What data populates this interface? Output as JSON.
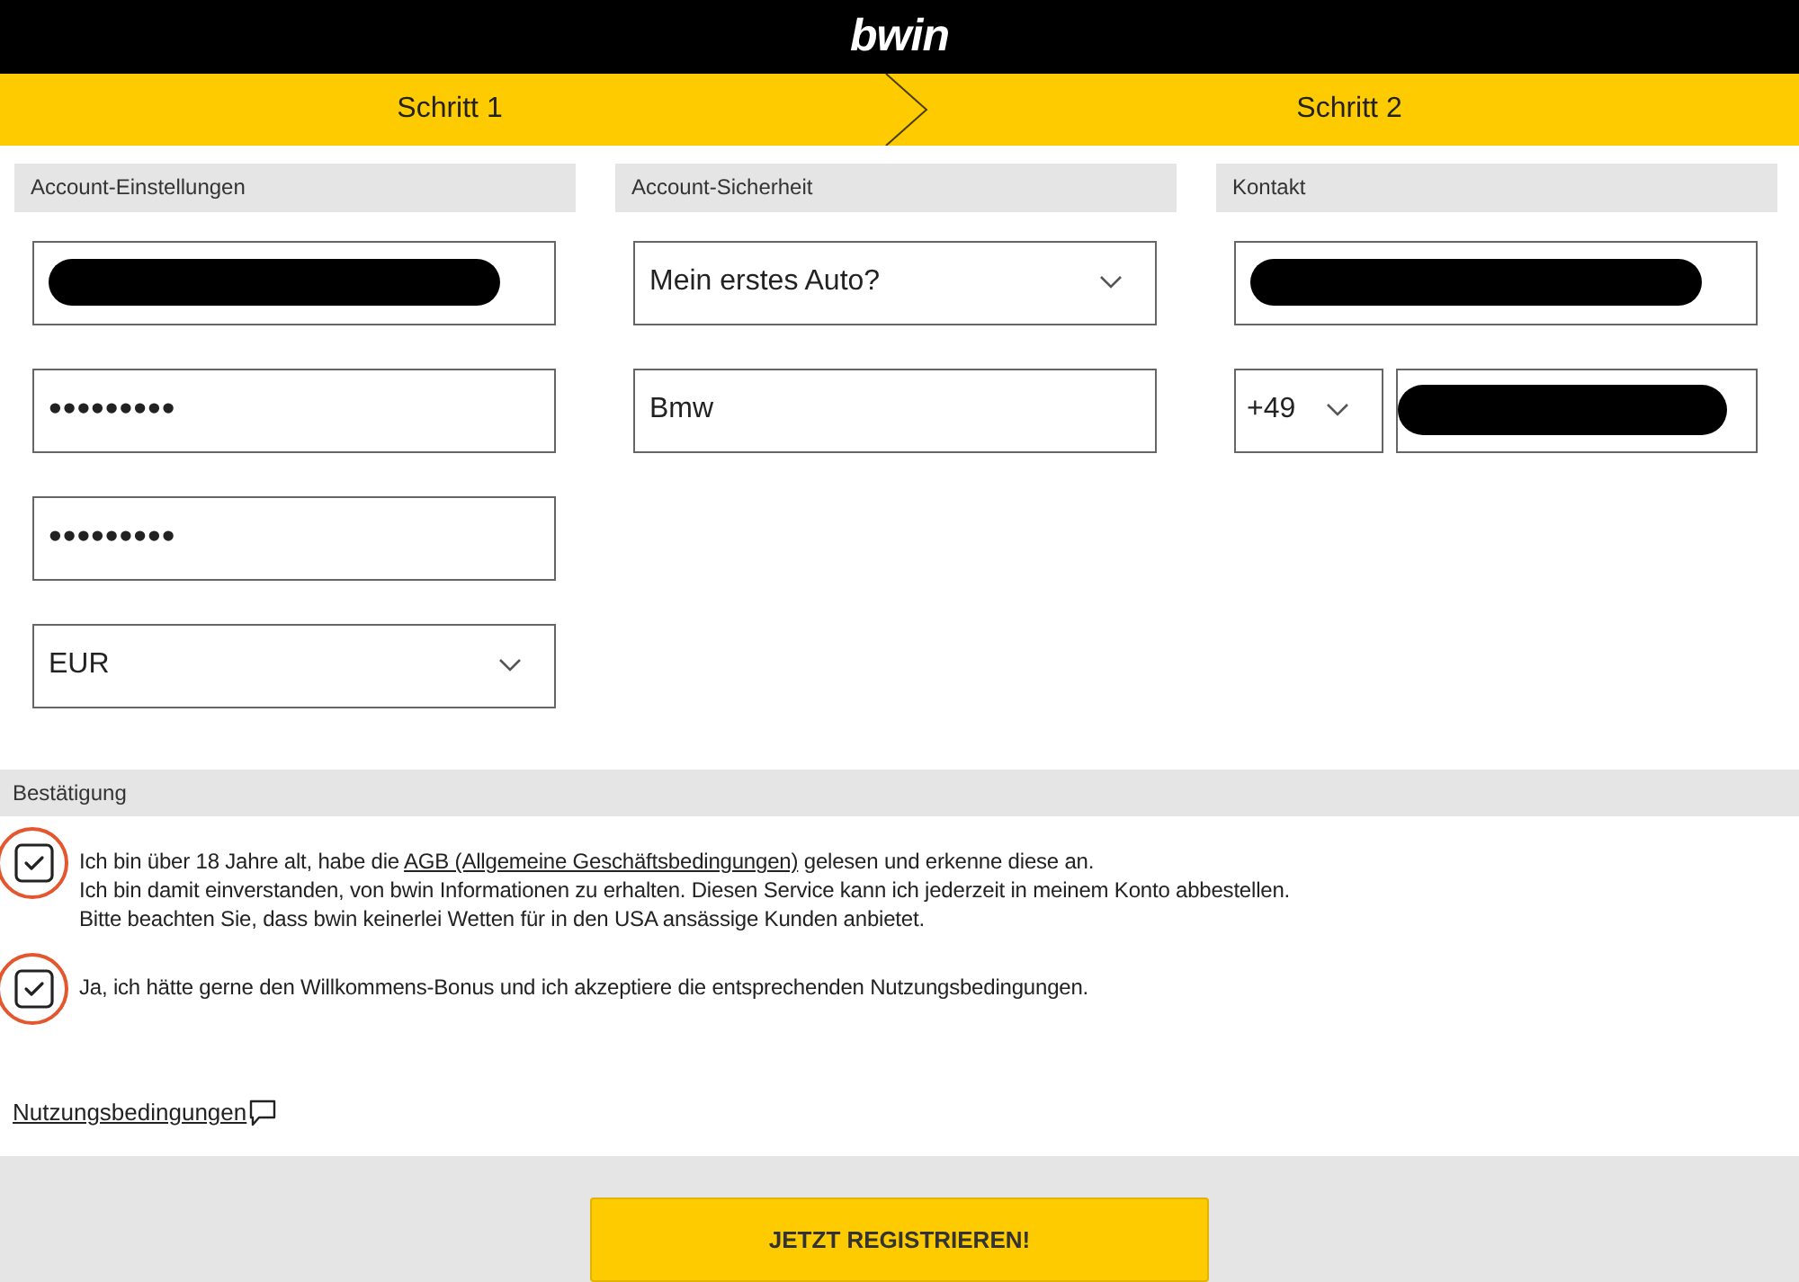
{
  "header": {
    "logo": "bwin"
  },
  "steps": [
    {
      "label": "Schritt 1"
    },
    {
      "label": "Schritt 2"
    }
  ],
  "sections": [
    {
      "title": "Account-Einstellungen",
      "fields": [
        {
          "kind": "text",
          "redacted": true
        },
        {
          "kind": "password",
          "value": "•••••••••"
        },
        {
          "kind": "password",
          "value": "•••••••••"
        },
        {
          "kind": "select",
          "value": "EUR"
        }
      ]
    },
    {
      "title": "Account-Sicherheit",
      "fields": [
        {
          "kind": "select",
          "value": "Mein erstes Auto?"
        },
        {
          "kind": "text",
          "value": "Bmw"
        }
      ]
    },
    {
      "title": "Kontakt",
      "fields": [
        {
          "kind": "text",
          "redacted": true
        },
        {
          "kind": "phone",
          "prefix": "+49",
          "redacted": true
        }
      ]
    }
  ],
  "confirmation": {
    "title": "Bestätigung",
    "consents": [
      {
        "checked": true,
        "highlighted": true,
        "lines": [
          [
            {
              "kind": "text",
              "text": "Ich bin über 18 Jahre alt, habe die "
            },
            {
              "kind": "link",
              "text": "AGB (Allgemeine Geschäftsbedingungen)"
            },
            {
              "kind": "text",
              "text": " gelesen und erkenne diese an."
            }
          ],
          [
            {
              "kind": "text",
              "text": "Ich bin damit einverstanden, von bwin Informationen zu erhalten. Diesen Service kann ich jederzeit in meinem Konto abbestellen."
            }
          ],
          [
            {
              "kind": "text",
              "text": "Bitte beachten Sie, dass bwin keinerlei Wetten für in den USA ansässige Kunden anbietet."
            }
          ]
        ]
      },
      {
        "checked": true,
        "highlighted": true,
        "lines": [
          [
            {
              "kind": "text",
              "text": "Ja, ich hätte gerne den Willkommens-Bonus und ich akzeptiere die entsprechenden Nutzungsbedingungen."
            }
          ]
        ]
      }
    ]
  },
  "terms_link": "Nutzungsbedingungen",
  "submit_button": "JETZT REGISTRIEREN!"
}
